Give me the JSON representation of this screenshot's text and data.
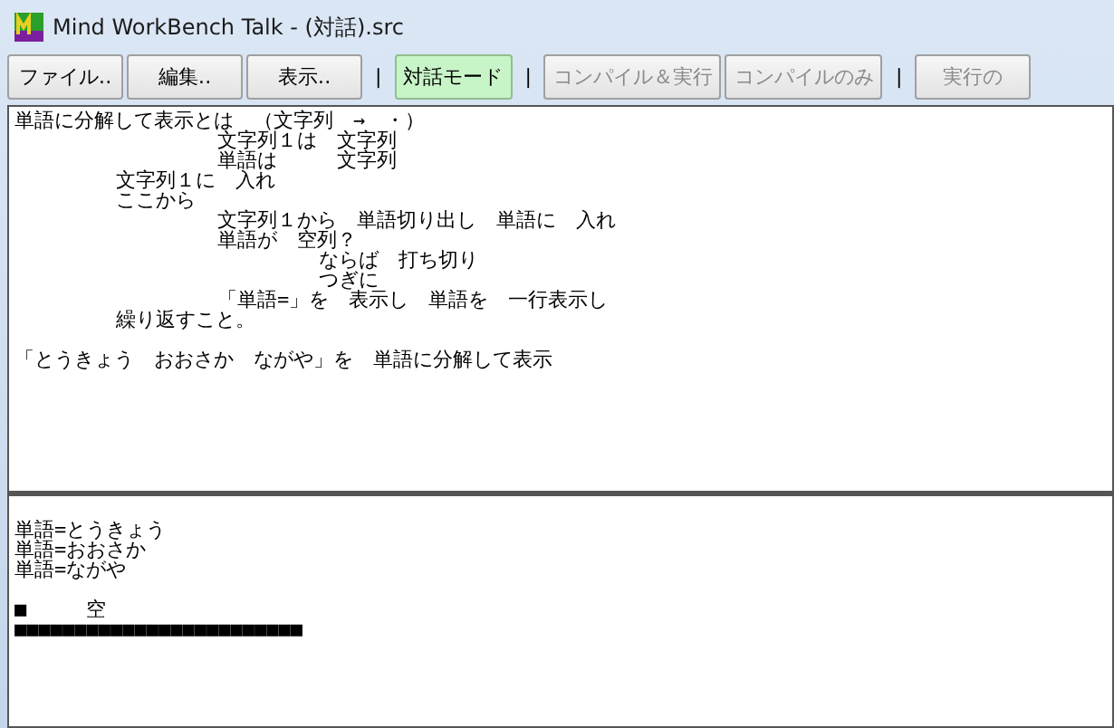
{
  "window": {
    "title": "Mind WorkBench Talk - (対話).src"
  },
  "toolbar": [
    {
      "kind": "button",
      "label": "ファイル‥",
      "selected": false,
      "disabled": false
    },
    {
      "kind": "button",
      "label": "編集‥",
      "selected": false,
      "disabled": false
    },
    {
      "kind": "button",
      "label": "表示‥",
      "selected": false,
      "disabled": false
    },
    {
      "kind": "separator",
      "label": "|"
    },
    {
      "kind": "button",
      "label": "対話モード",
      "selected": true,
      "disabled": false
    },
    {
      "kind": "separator",
      "label": "|"
    },
    {
      "kind": "button",
      "label": "コンパイル＆実行",
      "selected": false,
      "disabled": true
    },
    {
      "kind": "button",
      "label": "コンパイルのみ",
      "selected": false,
      "disabled": true
    },
    {
      "kind": "separator",
      "label": "|"
    },
    {
      "kind": "button",
      "label": "実行の",
      "selected": false,
      "disabled": true
    }
  ],
  "editor": {
    "blocks": [
      [
        "単語に分解して表示とは　（文字列　→　・）",
        "\t\t文字列１は　文字列",
        "\t\t単語は　　　文字列",
        "\t文字列１に　入れ",
        "\tここから",
        "\t\t文字列１から　単語切り出し　単語に　入れ",
        "\t\t単語が　空列？",
        "\t\t\tならば　打ち切り",
        "\t\t\tつぎに",
        "\t\t「単語=」を　表示し　単語を　一行表示し",
        "\t繰り返すこと。"
      ],
      [
        "「とうきょう　おおさか　ながや」を　単語に分解して表示"
      ]
    ]
  },
  "output": {
    "blocks": [
      [
        "単語=とうきょう",
        "単語=おおさか",
        "単語=ながや"
      ],
      [
        "■　　　空",
        "■■■■■■■■■■■■■■■■■■■■■■■■"
      ]
    ]
  }
}
